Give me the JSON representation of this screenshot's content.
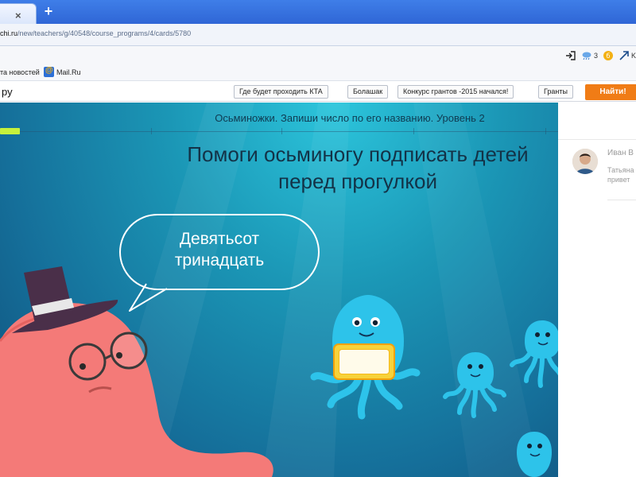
{
  "browser": {
    "tab_close": "×",
    "new_tab": "+",
    "url": {
      "host": "chi.ru",
      "path": "/new/teachers/g/40548/course_programs/4/cards/5780"
    },
    "toolbar": {
      "login_icon": "sign-in-icon",
      "weather_icon": "cloud-rain-icon",
      "weather_value": "3",
      "currency_icon": "ruble-coin-icon",
      "extension_label": "K"
    }
  },
  "bookmarks": [
    {
      "label": "та новостей"
    },
    {
      "label": "Mail.Ru",
      "icon": "mailru-icon"
    }
  ],
  "search": {
    "value": "ру",
    "chips": [
      "Где будет проходить КТА",
      "Болашак",
      "Конкурс грантов -2015 начался!",
      "Гранты"
    ],
    "find_button": "Найти!"
  },
  "game": {
    "lesson_title": "Осьминожки. Запиши число по его названию. Уровень 2",
    "progress": 0.035,
    "task_line1": "Помоги осьминогу подписать детей",
    "task_line2": "перед прогулкой",
    "bubble_line1": "Девятьсот",
    "bubble_line2": "тринадцать",
    "answer_value": "",
    "colors": {
      "water_top": "#2cc5dc",
      "water_bottom": "#104d78",
      "octopus_blue": "#2dc3ea",
      "octopus_pink": "#f47a78",
      "progress": "#c6f13c"
    }
  },
  "sidebar": {
    "name": "Иван В",
    "snippet_line1": "Татьяна",
    "snippet_line2": "привет"
  }
}
